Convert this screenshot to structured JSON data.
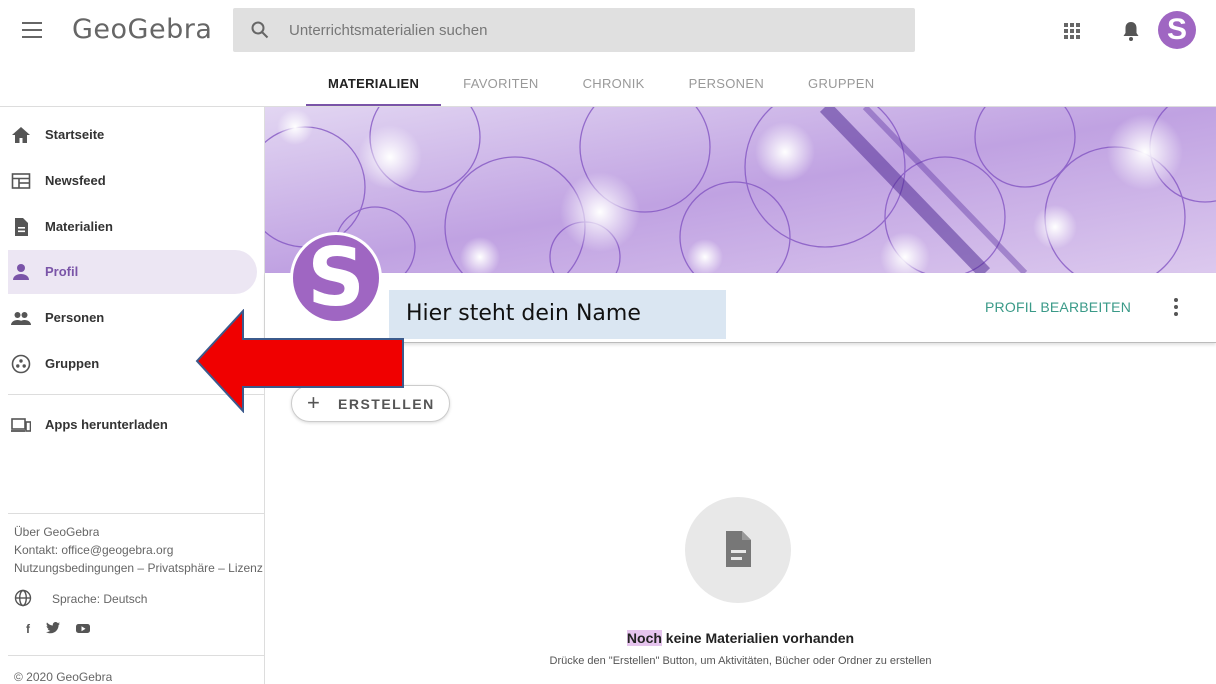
{
  "header": {
    "logo": "GeoGebra",
    "search_placeholder": "Unterrichtsmaterialien suchen",
    "avatar_letter": "S"
  },
  "tabs": [
    {
      "label": "MATERIALIEN",
      "active": true
    },
    {
      "label": "FAVORITEN"
    },
    {
      "label": "CHRONIK"
    },
    {
      "label": "PERSONEN"
    },
    {
      "label": "GRUPPEN"
    }
  ],
  "sidebar": {
    "items": [
      {
        "label": "Startseite",
        "icon": "home-icon"
      },
      {
        "label": "Newsfeed",
        "icon": "newsfeed-icon"
      },
      {
        "label": "Materialien",
        "icon": "document-icon"
      },
      {
        "label": "Profil",
        "icon": "person-icon",
        "active": true
      },
      {
        "label": "Personen",
        "icon": "people-icon"
      },
      {
        "label": "Gruppen",
        "icon": "groups-icon"
      },
      {
        "label": "Apps herunterladen",
        "icon": "devices-icon"
      }
    ],
    "footer": {
      "about": "Über GeoGebra",
      "contact": "Kontakt: office@geogebra.org",
      "legal": "Nutzungsbedingungen – Privatsphäre – Lizenz",
      "language": "Sprache: Deutsch",
      "social": [
        "f",
        "twitter",
        "youtube"
      ],
      "copyright": "© 2020 GeoGebra"
    }
  },
  "profile": {
    "avatar_letter": "S",
    "name": "Hier steht dein Name",
    "edit_label": "PROFIL BEARBEITEN",
    "accent_color": "#9f66c2"
  },
  "create_button": {
    "label": "ERSTELLEN"
  },
  "empty_state": {
    "title_highlight": "Noch",
    "title_rest": " keine Materialien vorhanden",
    "subtitle": "Drücke den \"Erstellen\" Button, um Aktivitäten, Bücher oder Ordner zu erstellen"
  }
}
